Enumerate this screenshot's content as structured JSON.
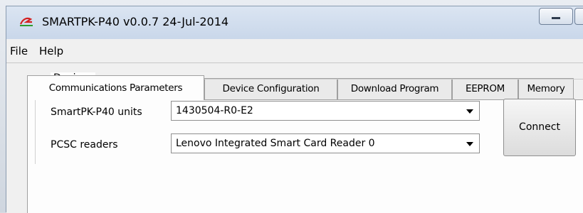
{
  "window": {
    "title": "SMARTPK-P40 v0.0.7 24-Jul-2014"
  },
  "menubar": {
    "items": [
      {
        "label": "File"
      },
      {
        "label": "Help"
      }
    ]
  },
  "tabs": [
    {
      "label": "Communications Parameters",
      "active": true
    },
    {
      "label": "Device Configuration",
      "active": false
    },
    {
      "label": "Download Program",
      "active": false
    },
    {
      "label": "EEPROM",
      "active": false
    },
    {
      "label": "Memory",
      "active": false
    }
  ],
  "devices": {
    "group_label": "Devices",
    "units_label": "SmartPK-P40 units",
    "units_value": "1430504-R0-E2",
    "readers_label": "PCSC readers",
    "readers_value": "Lenovo Integrated Smart Card Reader 0",
    "connect_label": "Connect"
  },
  "colors": {
    "titlebar": "#c9d7ea",
    "window_bg": "#f0f0f0",
    "panel_bg": "#fdfdfd",
    "icon_red": "#d42020",
    "icon_green": "#2e9a2e"
  },
  "icons": [
    "app-logo-icon",
    "minimize-icon",
    "chevron-down-icon"
  ]
}
